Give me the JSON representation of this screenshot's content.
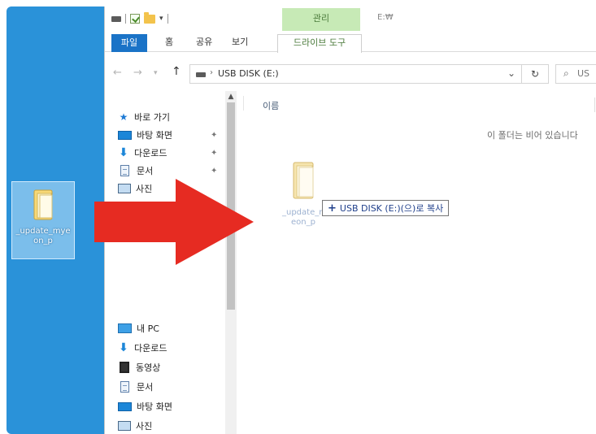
{
  "desktop": {
    "icon_label": "_update_mye\non_p"
  },
  "titlebar": {
    "context_group": "관리",
    "window_title": "E:₩"
  },
  "ribbon": {
    "tabs": [
      "파일",
      "홈",
      "공유",
      "보기",
      "드라이브 도구"
    ]
  },
  "address": {
    "path": "USB DISK (E:)",
    "chevron": "›",
    "search_placeholder": "US"
  },
  "navpane": {
    "quick_access": "바로 가기",
    "items": [
      "바탕 화면",
      "다운로드",
      "문서",
      "사진"
    ],
    "this_pc": "내 PC",
    "pc_items": [
      "다운로드",
      "동영상",
      "문서",
      "바탕 화면",
      "사진"
    ]
  },
  "content": {
    "column_name": "이름",
    "empty_message": "이 폴더는 비어 있습니다",
    "drag_item_label": "_update_my\neon_p",
    "tooltip_text": "USB DISK (E:)(으)로 복사"
  },
  "colors": {
    "desktop": "#2a92d9",
    "file_tab": "#1a73c7",
    "context_tab": "#c7eab6",
    "arrow": "#e62b22"
  },
  "icons": [
    "drive-icon",
    "check-icon",
    "folder-icon",
    "back-icon",
    "forward-icon",
    "up-icon",
    "refresh-icon",
    "search-icon",
    "star-icon",
    "desktop-icon",
    "download-icon",
    "document-icon",
    "picture-icon",
    "pc-icon",
    "video-icon",
    "pin-icon",
    "plus-icon",
    "red-arrow-icon"
  ]
}
